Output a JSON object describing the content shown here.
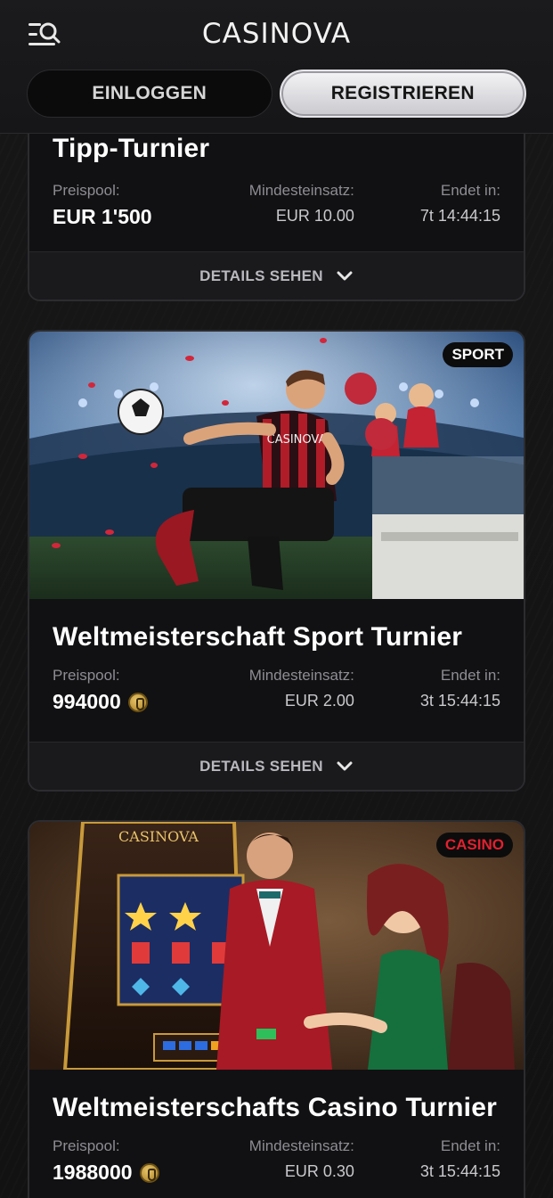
{
  "header": {
    "logo": "CASINOVA",
    "login_label": "EINLOGGEN",
    "register_label": "REGISTRIEREN"
  },
  "cards": [
    {
      "title": "Tipp-Turnier",
      "prize_label": "Preispool:",
      "prize_value": "EUR 1'500",
      "min_label": "Mindesteinsatz:",
      "min_value": "EUR 10.00",
      "end_label": "Endet in:",
      "end_value": "7t 14:44:15",
      "details_label": "DETAILS SEHEN"
    },
    {
      "badge": "SPORT",
      "badge_color": "#ffffff",
      "title": "Weltmeisterschaft Sport Turnier",
      "prize_label": "Preispool:",
      "prize_value": "994000",
      "min_label": "Mindesteinsatz:",
      "min_value": "EUR 2.00",
      "end_label": "Endet in:",
      "end_value": "3t 15:44:15",
      "details_label": "DETAILS SEHEN"
    },
    {
      "badge": "CASINO",
      "badge_color": "#e2202f",
      "title": "Weltmeisterschafts Casino Turnier",
      "prize_label": "Preispool:",
      "prize_value": "1988000",
      "min_label": "Mindesteinsatz:",
      "min_value": "EUR 0.30",
      "end_label": "Endet in:",
      "end_value": "3t 15:44:15"
    }
  ],
  "image_texts": {
    "jersey_logo": "CASINOVA",
    "slot_logo": "CASINOVA"
  }
}
